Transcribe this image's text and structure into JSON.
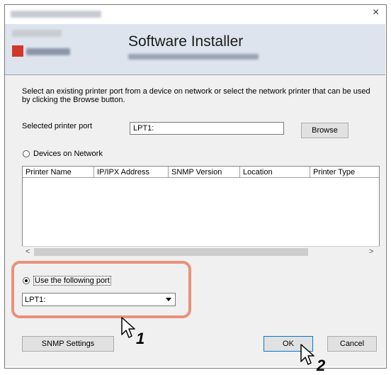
{
  "window": {
    "close_glyph": "×"
  },
  "banner": {
    "title": "Software Installer"
  },
  "instructions": "Select an existing printer port from a device on network or select the network printer that can be used by clicking the Browse button.",
  "selected_port": {
    "label": "Selected printer port",
    "value": "LPT1:",
    "browse_label": "Browse"
  },
  "devices": {
    "radio_label": "Devices on Network",
    "columns": [
      "Printer Name",
      "IP/IPX Address",
      "SNMP Version",
      "Location",
      "Printer Type"
    ],
    "rows": []
  },
  "scroll": {
    "left_glyph": "<",
    "right_glyph": ">"
  },
  "use_port": {
    "radio_label": "Use the following port",
    "selected": "LPT1:"
  },
  "buttons": {
    "snmp": "SNMP Settings",
    "ok": "OK",
    "cancel": "Cancel"
  },
  "callouts": {
    "step1": "1",
    "step2": "2"
  },
  "colors": {
    "highlight": "#e8927a",
    "dialog_bg": "#f0f0f0",
    "banner_bg": "#dde4ee"
  },
  "icons": [
    "close-icon",
    "brand-logo-icon",
    "radio-icon",
    "scroll-left-icon",
    "scroll-right-icon",
    "dropdown-arrow-icon",
    "mouse-cursor-icon"
  ]
}
